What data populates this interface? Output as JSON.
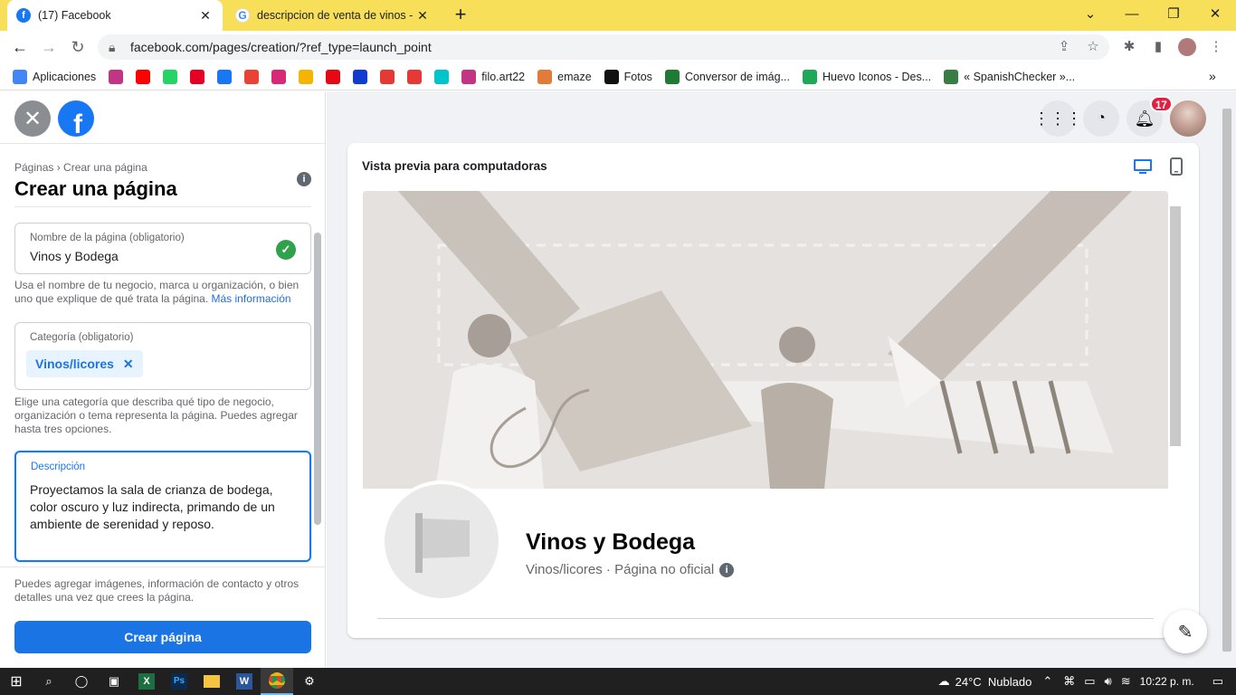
{
  "browser": {
    "tabs": [
      {
        "title": "(17) Facebook"
      },
      {
        "title": "descripcion de venta de vinos - E"
      }
    ],
    "url": "facebook.com/pages/creation/?ref_type=launch_point",
    "bookmarks": [
      {
        "label": "Aplicaciones",
        "icon": "apps-grid-icon",
        "color": "#4285f4"
      },
      {
        "label": "",
        "icon": "instagram-icon",
        "color": "#c13584"
      },
      {
        "label": "",
        "icon": "youtube-icon",
        "color": "#ff0000"
      },
      {
        "label": "",
        "icon": "whatsapp-icon",
        "color": "#25d366"
      },
      {
        "label": "",
        "icon": "pinterest-icon",
        "color": "#e60023"
      },
      {
        "label": "",
        "icon": "facebook-icon",
        "color": "#1877f2"
      },
      {
        "label": "",
        "icon": "gmail-icon",
        "color": "#ea4335"
      },
      {
        "label": "",
        "icon": "instagram-icon",
        "color": "#d62976"
      },
      {
        "label": "",
        "icon": "id-card-icon",
        "color": "#f4b400"
      },
      {
        "label": "",
        "icon": "netflix-icon",
        "color": "#e50914"
      },
      {
        "label": "",
        "icon": "disney-icon",
        "color": "#113ccf"
      },
      {
        "label": "",
        "icon": "star-icon",
        "color": "#e53935"
      },
      {
        "label": "",
        "icon": "heart-icon",
        "color": "#e53935"
      },
      {
        "label": "",
        "icon": "canva-icon",
        "color": "#00c4cc"
      },
      {
        "label": "filo.art22",
        "icon": "instagram-icon",
        "color": "#c13584"
      },
      {
        "label": "emaze",
        "icon": "emaze-icon",
        "color": "#e07b39"
      },
      {
        "label": "Fotos",
        "icon": "tiktok-icon",
        "color": "#111111"
      },
      {
        "label": "Conversor de imág...",
        "icon": "converter-icon",
        "color": "#1e7b34"
      },
      {
        "label": "Huevo Iconos - Des...",
        "icon": "huevo-icon",
        "color": "#1fa855"
      },
      {
        "label": "« SpanishChecker »...",
        "icon": "checker-icon",
        "color": "#3a7d44"
      }
    ]
  },
  "left": {
    "breadcrumb": "Páginas › Crear una página",
    "title": "Crear una página",
    "name_field": {
      "label": "Nombre de la página (obligatorio)",
      "value": "Vinos y Bodega"
    },
    "name_help": "Usa el nombre de tu negocio, marca u organización, o bien uno que explique de qué trata la página.",
    "name_help_link": "Más información",
    "category_field": {
      "label": "Categoría (obligatorio)",
      "chip": "Vinos/licores"
    },
    "category_help": "Elige una categoría que describa qué tipo de negocio, organización o tema representa la página. Puedes agregar hasta tres opciones.",
    "description_field": {
      "label": "Descripción",
      "value": "Proyectamos la sala de crianza de bodega, color oscuro y luz indirecta, primando de un ambiente de serenidad y reposo."
    },
    "footer_help": "Puedes agregar imágenes, información de contacto y otros detalles una vez que crees la página.",
    "create_button": "Crear página"
  },
  "right": {
    "notifications_count": "17",
    "preview_title": "Vista previa para computadoras",
    "page_name": "Vinos y Bodega",
    "page_category": "Vinos/licores",
    "page_status": "Página no oficial"
  },
  "taskbar": {
    "weather": "24°C  Nublado",
    "time": "10:22 p. m."
  },
  "colors": {
    "accent": "#1877f2",
    "tabstrip": "#f8df5a",
    "badge": "#e41e3f",
    "success": "#31a24c"
  }
}
